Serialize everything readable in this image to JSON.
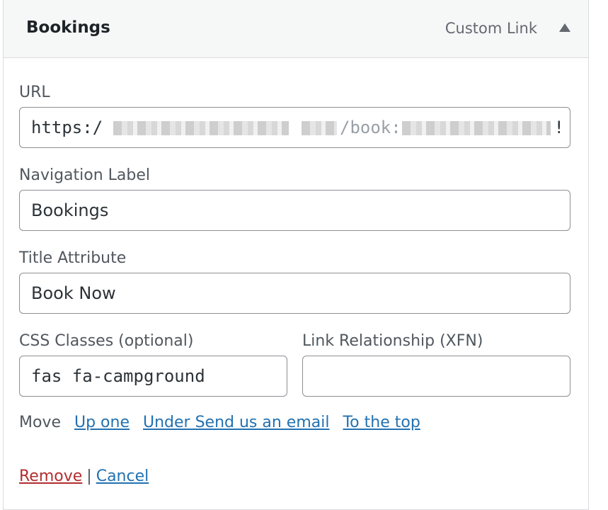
{
  "item": {
    "title": "Bookings",
    "type_label": "Custom Link"
  },
  "fields": {
    "url": {
      "label": "URL",
      "value_start": "https:/",
      "value_middle": "/book:",
      "value_end": "!"
    },
    "navigation_label": {
      "label": "Navigation Label",
      "value": "Bookings"
    },
    "title_attribute": {
      "label": "Title Attribute",
      "value": "Book Now"
    },
    "css_classes": {
      "label": "CSS Classes (optional)",
      "value": "fas fa-campground"
    },
    "link_relationship": {
      "label": "Link Relationship (XFN)",
      "value": ""
    }
  },
  "move": {
    "label": "Move",
    "links": [
      "Up one",
      "Under Send us an email",
      "To the top"
    ]
  },
  "actions": {
    "remove": "Remove",
    "separator": "|",
    "cancel": "Cancel"
  },
  "colors": {
    "link": "#2271b1",
    "remove": "#b32d2e",
    "border": "#8c8f94"
  },
  "icons": {
    "toggle": "triangle-up-icon"
  }
}
